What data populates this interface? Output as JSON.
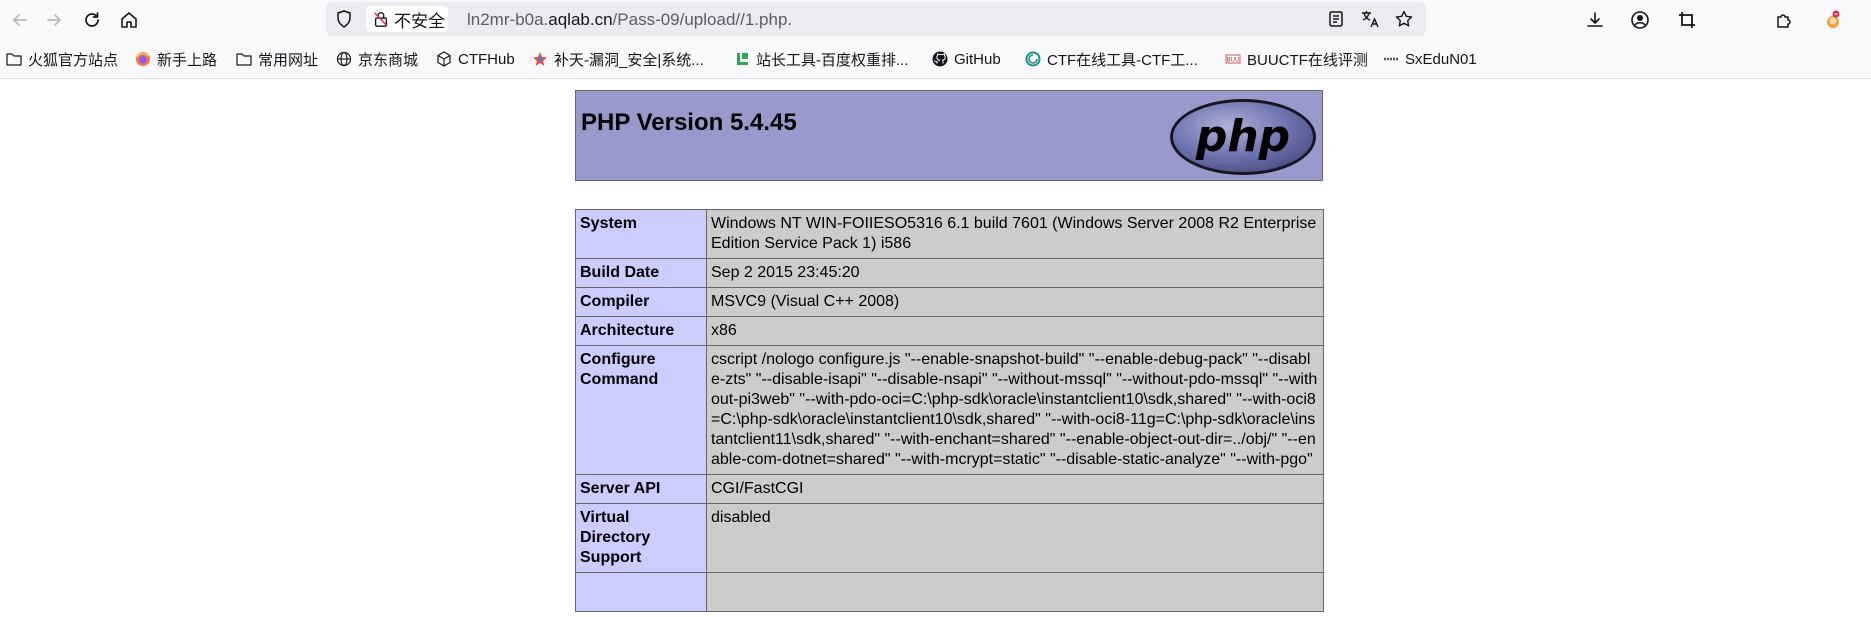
{
  "browser": {
    "url": {
      "insecure_label": "不安全",
      "prefix": "ln2mr-b0a.",
      "host": "aqlab.cn",
      "path": "/Pass-09/upload//1.php."
    },
    "nav_icons": [
      "back-icon",
      "forward-icon",
      "reload-icon",
      "home-icon"
    ],
    "right_icons": [
      "reader-view-icon",
      "translate-icon",
      "bookmark-star-icon",
      "download-icon",
      "account-icon",
      "screenshot-crop-icon",
      "extensions-icon",
      "profile-avatar-icon"
    ]
  },
  "bookmarks": [
    {
      "label": "火狐官方站点",
      "icon": "folder-icon"
    },
    {
      "label": "新手上路",
      "icon": "firefox-icon"
    },
    {
      "label": "常用网址",
      "icon": "folder-icon"
    },
    {
      "label": "京东商城",
      "icon": "globe-icon"
    },
    {
      "label": "CTFHub",
      "icon": "cube-icon"
    },
    {
      "label": "补天-漏洞_安全|系统...",
      "icon": "butian-icon"
    },
    {
      "label": "站长工具-百度权重排...",
      "icon": "chinaz-icon"
    },
    {
      "label": "GitHub",
      "icon": "github-icon"
    },
    {
      "label": "CTF在线工具-CTF工...",
      "icon": "ctftool-icon"
    },
    {
      "label": "BUUCTF在线评测",
      "icon": "buuctf-icon"
    },
    {
      "label": "SxEduN01",
      "icon": "sxedu-icon"
    }
  ],
  "phpinfo": {
    "title": "PHP Version 5.4.45",
    "logo_text": "php",
    "rows": [
      {
        "key": "System",
        "value": "Windows NT WIN-FOIIESO5316 6.1 build 7601 (Windows Server 2008 R2 Enterprise Edition Service Pack 1) i586"
      },
      {
        "key": "Build Date",
        "value": "Sep 2 2015 23:45:20"
      },
      {
        "key": "Compiler",
        "value": "MSVC9 (Visual C++ 2008)"
      },
      {
        "key": "Architecture",
        "value": "x86"
      },
      {
        "key": "Configure Command",
        "value": "cscript /nologo configure.js \"--enable-snapshot-build\" \"--enable-debug-pack\" \"--disable-zts\" \"--disable-isapi\" \"--disable-nsapi\" \"--without-mssql\" \"--without-pdo-mssql\" \"--without-pi3web\" \"--with-pdo-oci=C:\\php-sdk\\oracle\\instantclient10\\sdk,shared\" \"--with-oci8=C:\\php-sdk\\oracle\\instantclient10\\sdk,shared\" \"--with-oci8-11g=C:\\php-sdk\\oracle\\instantclient11\\sdk,shared\" \"--with-enchant=shared\" \"--enable-object-out-dir=../obj/\" \"--enable-com-dotnet=shared\" \"--with-mcrypt=static\" \"--disable-static-analyze\" \"--with-pgo\""
      },
      {
        "key": "Server API",
        "value": "CGI/FastCGI"
      },
      {
        "key": "Virtual Directory Support",
        "value": "disabled"
      },
      {
        "key": "",
        "value": ""
      }
    ]
  }
}
